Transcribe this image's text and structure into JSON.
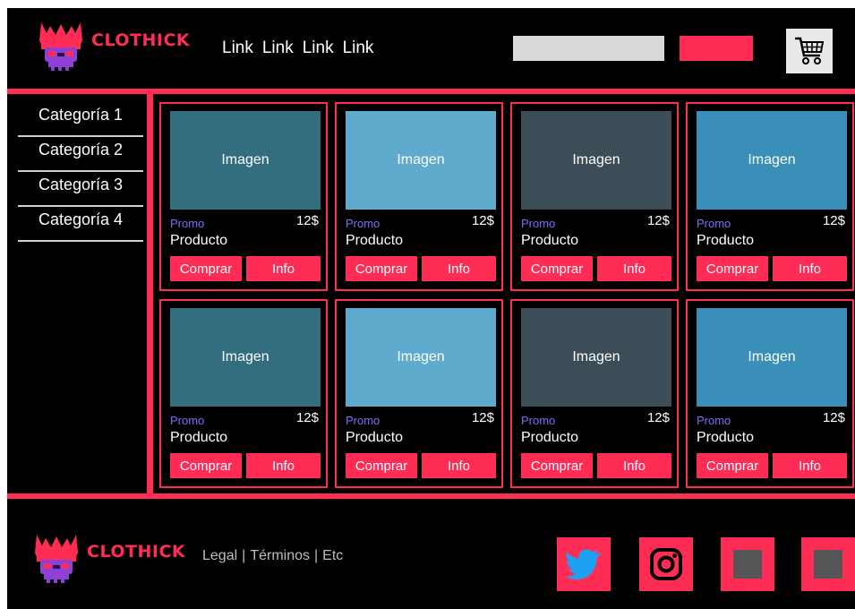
{
  "header": {
    "brand": "CLOTHICK",
    "nav": [
      "Link",
      "Link",
      "Link",
      "Link"
    ],
    "search_placeholder": "",
    "search_button_label": "",
    "cart_icon": "shopping-cart-icon"
  },
  "sidebar": {
    "categories": [
      "Categoría 1",
      "Categoría 2",
      "Categoría 3",
      "Categoría 4"
    ]
  },
  "products": [
    {
      "image": "Imagen",
      "promo": "Promo",
      "price": "12$",
      "name": "Producto",
      "buy": "Comprar",
      "info": "Info",
      "color": "#336e80"
    },
    {
      "image": "Imagen",
      "promo": "Promo",
      "price": "12$",
      "name": "Producto",
      "buy": "Comprar",
      "info": "Info",
      "color": "#5fabcd"
    },
    {
      "image": "Imagen",
      "promo": "Promo",
      "price": "12$",
      "name": "Producto",
      "buy": "Comprar",
      "info": "Info",
      "color": "#3c4d57"
    },
    {
      "image": "Imagen",
      "promo": "Promo",
      "price": "12$",
      "name": "Producto",
      "buy": "Comprar",
      "info": "Info",
      "color": "#3a8fb8"
    },
    {
      "image": "Imagen",
      "promo": "Promo",
      "price": "12$",
      "name": "Producto",
      "buy": "Comprar",
      "info": "Info",
      "color": "#336e80"
    },
    {
      "image": "Imagen",
      "promo": "Promo",
      "price": "12$",
      "name": "Producto",
      "buy": "Comprar",
      "info": "Info",
      "color": "#5fabcd"
    },
    {
      "image": "Imagen",
      "promo": "Promo",
      "price": "12$",
      "name": "Producto",
      "buy": "Comprar",
      "info": "Info",
      "color": "#3c4d57"
    },
    {
      "image": "Imagen",
      "promo": "Promo",
      "price": "12$",
      "name": "Producto",
      "buy": "Comprar",
      "info": "Info",
      "color": "#3a8fb8"
    }
  ],
  "footer": {
    "brand": "CLOTHICK",
    "legal": [
      "Legal",
      "Términos",
      "Etc"
    ],
    "legal_separator": "|",
    "social": [
      "twitter-icon",
      "instagram-icon",
      "social-placeholder-icon",
      "social-placeholder-icon"
    ]
  },
  "colors": {
    "accent": "#ff2d55",
    "background": "#000000",
    "promo": "#7b6dff",
    "logo_purple": "#8f3fd6"
  }
}
